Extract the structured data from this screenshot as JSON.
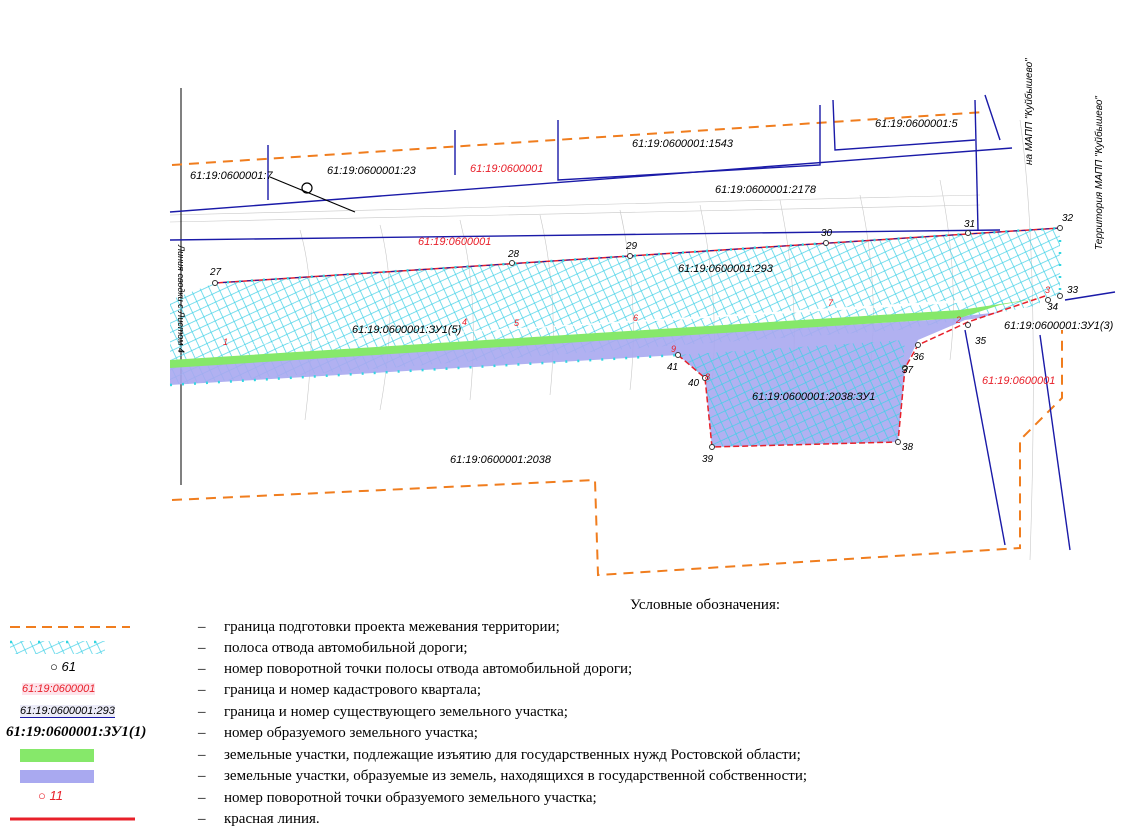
{
  "map": {
    "quarters": [
      "61:19:0600001",
      "61:19:0600001",
      "61:19:0600001"
    ],
    "parcels": {
      "p7": "61:19:0600001:7",
      "p23": "61:19:0600001:23",
      "p1543": "61:19:0600001:1543",
      "p5": "61:19:0600001:5",
      "p2178": "61:19:0600001:2178",
      "p293": "61:19:0600001:293",
      "p2038": "61:19:0600001:2038"
    },
    "new_parcels": {
      "zu5": "61:19:0600001:ЗУ1(5)",
      "zu3": "61:19:0600001:ЗУ1(3)",
      "zu_main": "61:19:0600001:2038:ЗУ1"
    },
    "road_points": [
      "27",
      "28",
      "29",
      "30",
      "31",
      "32",
      "33",
      "34",
      "35",
      "36",
      "37",
      "38",
      "39",
      "40",
      "41"
    ],
    "parcel_points": [
      "1",
      "2",
      "3",
      "4",
      "5",
      "6",
      "7",
      "8",
      "9"
    ],
    "side_labels": {
      "left": "Линия сводки с Листом 4",
      "top_right_1": "на МАПП \"Куйбышево\"",
      "top_right_2": "Территория МАПП \"Куйбышево\""
    }
  },
  "legend": {
    "title": "Условные обозначения:",
    "sample_point": "61",
    "sample_quarter": "61:19:0600001",
    "sample_parcel": "61:19:0600001:293",
    "sample_new_parcel": "61:19:0600001:ЗУ1(1)",
    "sample_parcel_point": "11",
    "dash": "–",
    "items": [
      "граница подготовки проекта межевания территории;",
      "полоса отвода автомобильной дороги;",
      "номер поворотной точки полосы отвода автомобильной дороги;",
      "граница и номер кадастрового квартала;",
      "граница и номер существующего земельного участка;",
      "номер образуемого земельного участка;",
      "земельные участки, подлежащие изъятию для государственных нужд Ростовской области;",
      "земельные участки, образуемые из земель, находящихся в государственной собственности;",
      "номер поворотной точки образуемого земельного участка;",
      "красная линия."
    ],
    "colors": {
      "project_boundary": "#f07d1e",
      "road_strip": "#33d6e0",
      "quarter": "#e8202a",
      "parcel": "#1a1aa8",
      "withdrawn": "#86e86a",
      "state_land": "#a9a9f0",
      "red_line": "#e8202a"
    }
  }
}
